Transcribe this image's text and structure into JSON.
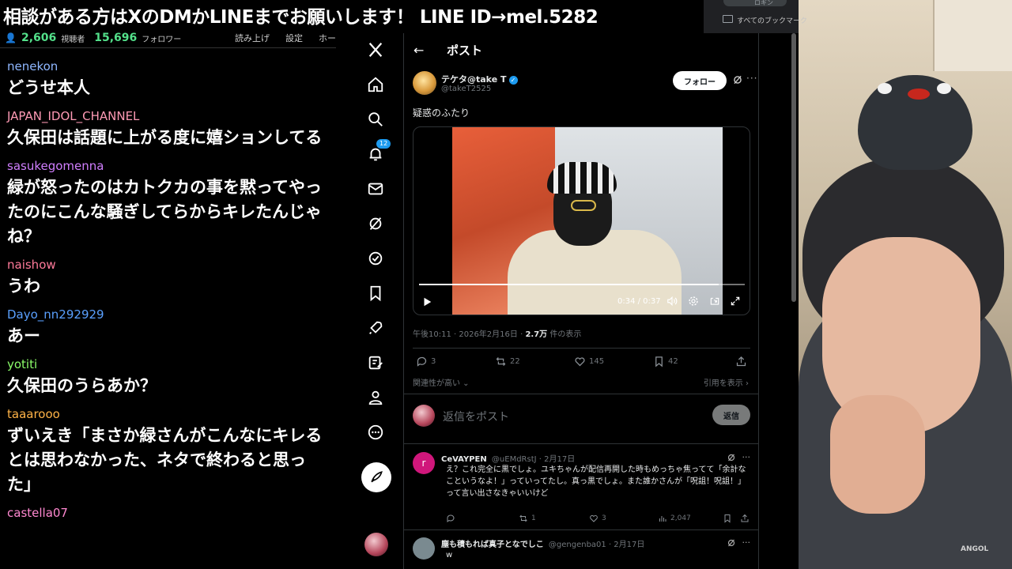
{
  "banner": {
    "text": "相談がある方はXのDMかLINEまでお願いします！ LINE ID→mel.5282"
  },
  "browser": {
    "bookmarks_label": "すべてのブックマーク",
    "tab_hint": "ロギン"
  },
  "chat": {
    "viewer_count": "2,606",
    "viewer_label": "視聴者",
    "follower_count": "15,696",
    "follower_label": "フォロワー",
    "links": [
      "読み上げ",
      "設定",
      "ホー"
    ],
    "messages": [
      {
        "user": "nenekon",
        "color": "#8fb7ff",
        "text": "どうせ本人"
      },
      {
        "user": "JAPAN_IDOL_CHANNEL",
        "color": "#ff9ab5",
        "text": "久保田は話題に上がる度に嬉ションしてる"
      },
      {
        "user": "sasukegomenna",
        "color": "#d17fff",
        "text": "緑が怒ったのはカトクカの事を黙ってやったのにこんな騒ぎしてらからキレたんじゃね？"
      },
      {
        "user": "naishow",
        "color": "#ff7a9a",
        "text": "うわ"
      },
      {
        "user": "Dayo_nn292929",
        "color": "#5aa0ff",
        "text": "あー"
      },
      {
        "user": "yotiti",
        "color": "#8cff6a",
        "text": "久保田のうらあか？"
      },
      {
        "user": "taaarooo",
        "color": "#ffb347",
        "text": "ずいえき「まさか緑さんがこんなにキレるとは思わなかった、ネタで終わると思った」"
      },
      {
        "user": "castella07",
        "color": "#ff88d0",
        "text": ""
      }
    ]
  },
  "xnav": {
    "notification_badge": "12"
  },
  "post": {
    "header_title": "ポスト",
    "author_name": "テケタ@take T",
    "author_handle": "@takeT2525",
    "verified_mark": "✓",
    "follow_label": "フォロー",
    "more_label": "···",
    "text": "疑惑のふたり",
    "video": {
      "time": "0:34 / 0:37",
      "progress": 0.92
    },
    "meta_time": "午後10:11 · 2026年2月16日 · ",
    "meta_views": "2.7万",
    "meta_views_label": " 件の表示",
    "stats": {
      "replies": "3",
      "reposts": "22",
      "likes": "145",
      "bookmarks": "42"
    },
    "sort_label": "関連性が高い ⌄",
    "quotes_label": "引用を表示 ›",
    "reply_placeholder": "返信をポスト",
    "reply_button": "返信"
  },
  "replies": [
    {
      "avatar_letter": "r",
      "avatar_color": "#d0177b",
      "name": "CeVAYPEN",
      "handle_date": "@uEMdRstJ · 2月17日",
      "body": "え？これ完全に黒でしょ。ユキちゃんが配信再開した時もめっちゃ焦ってて「余計なこというなよ！」っていってたし。真っ黒でしょ。また誰かさんが「呪詛！呪詛！」って言い出さなきゃいいけど",
      "stats": {
        "replies": "",
        "reposts": "1",
        "likes": "3",
        "views": "2,047"
      }
    },
    {
      "avatar_letter": "",
      "avatar_color": "#7a8a90",
      "name": "塵も積もれば真子となでしこ",
      "handle_date": "@gengenba01 · 2月17日",
      "body": "w"
    }
  ],
  "webcam": {
    "logo_text": "ANGOL"
  }
}
